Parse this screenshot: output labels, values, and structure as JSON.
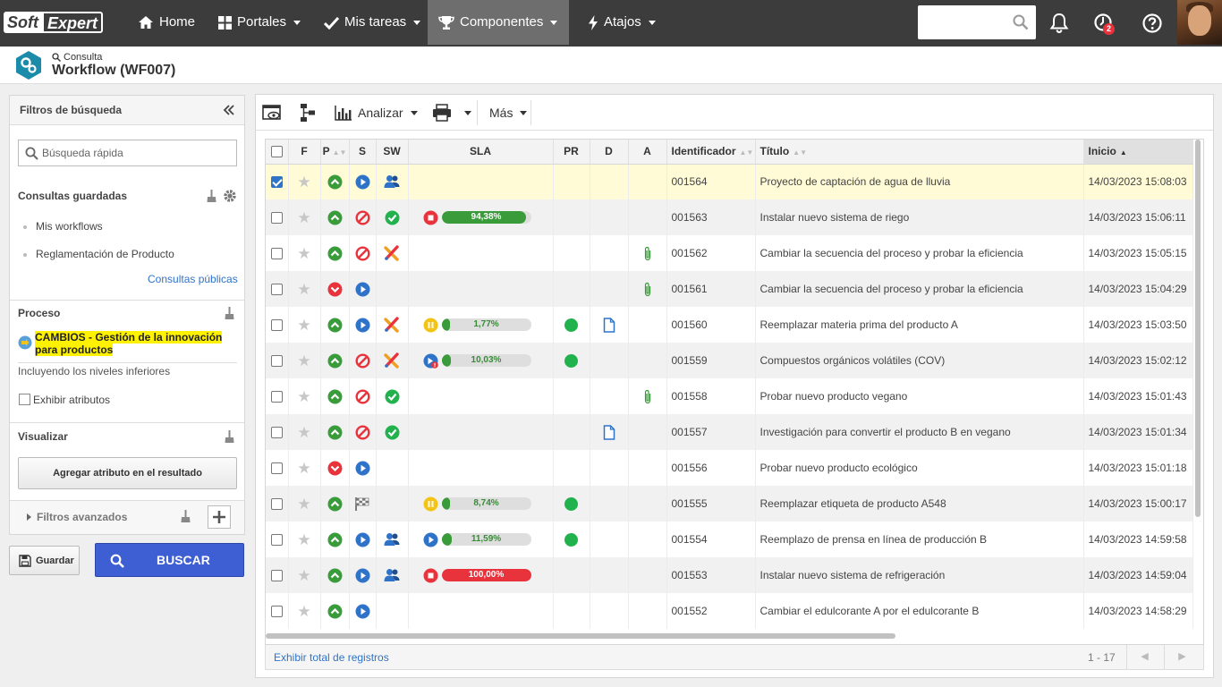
{
  "brand": {
    "part1": "Soft",
    "part2": "Expert"
  },
  "nav": [
    {
      "label": "Home",
      "icon": "home-icon"
    },
    {
      "label": "Portales",
      "icon": "grid-icon"
    },
    {
      "label": "Mis tareas",
      "icon": "check-icon"
    },
    {
      "label": "Componentes",
      "icon": "trophy-icon",
      "active": true
    },
    {
      "label": "Atajos",
      "icon": "bolt-icon"
    }
  ],
  "search": {
    "placeholder": ""
  },
  "notifications": {
    "badge": "2"
  },
  "header": {
    "small": "Consulta",
    "title": "Workflow (WF007)"
  },
  "filters": {
    "title": "Filtros de búsqueda",
    "quick_search_placeholder": "Búsqueda rápida",
    "saved_title": "Consultas guardadas",
    "saved_items": [
      "Mis workflows",
      "Reglamentación de Producto"
    ],
    "public_link": "Consultas públicas",
    "process_title": "Proceso",
    "process_value_line1": "CAMBIOS - Gestión de la innovación",
    "process_value_line2": "para productos",
    "include_levels": "Incluyendo los niveles inferiores",
    "show_attributes": "Exhibir atributos",
    "visualize_title": "Visualizar",
    "add_attribute_button": "Agregar atributo en el resultado",
    "advanced_filters": "Filtros avanzados",
    "save_button": "Guardar",
    "search_button": "BUSCAR"
  },
  "toolbar": {
    "analyze": "Analizar",
    "more": "Más"
  },
  "table": {
    "columns": {
      "f": "F",
      "p": "P",
      "s": "S",
      "sw": "SW",
      "sla": "SLA",
      "pr": "PR",
      "d": "D",
      "a": "A",
      "id": "Identificador",
      "title": "Título",
      "start": "Inicio"
    },
    "rows": [
      {
        "checked": true,
        "p": "up",
        "s": "play",
        "sw": "user",
        "sla": null,
        "pr": false,
        "d": false,
        "a": false,
        "id": "001564",
        "title": "Proyecto de captación de agua de lluvia",
        "start": "14/03/2023 15:08:03"
      },
      {
        "checked": false,
        "p": "up",
        "s": "stop",
        "sw": "check",
        "sla": {
          "icon": "stop",
          "label": "94,38%",
          "pct": 94.38,
          "color": "#3a9b3a"
        },
        "pr": false,
        "d": false,
        "a": false,
        "id": "001563",
        "title": "Instalar nuevo sistema de riego",
        "start": "14/03/2023 15:06:11"
      },
      {
        "checked": false,
        "p": "up",
        "s": "stop",
        "sw": "cross",
        "sla": null,
        "pr": false,
        "d": false,
        "a": true,
        "id": "001562",
        "title": "Cambiar la secuencia del proceso y probar la eficiencia",
        "start": "14/03/2023 15:05:15"
      },
      {
        "checked": false,
        "p": "down",
        "s": "play",
        "sw": null,
        "sla": null,
        "pr": false,
        "d": false,
        "a": true,
        "id": "001561",
        "title": "Cambiar la secuencia del proceso y probar la eficiencia",
        "start": "14/03/2023 15:04:29"
      },
      {
        "checked": false,
        "p": "up",
        "s": "play",
        "sw": "cross",
        "sla": {
          "icon": "pause",
          "label": "1,77%",
          "pct": 1.77,
          "color": "#3a9b3a"
        },
        "pr": true,
        "d": true,
        "a": false,
        "id": "001560",
        "title": "Reemplazar materia prima del producto A",
        "start": "14/03/2023 15:03:50"
      },
      {
        "checked": false,
        "p": "up",
        "s": "stop",
        "sw": "cross",
        "sla": {
          "icon": "play-alert",
          "label": "10,03%",
          "pct": 10.03,
          "color": "#3a9b3a"
        },
        "pr": true,
        "d": false,
        "a": false,
        "id": "001559",
        "title": "Compuestos orgánicos volátiles (COV)",
        "start": "14/03/2023 15:02:12"
      },
      {
        "checked": false,
        "p": "up",
        "s": "stop",
        "sw": "check",
        "sla": null,
        "pr": false,
        "d": false,
        "a": true,
        "id": "001558",
        "title": "Probar nuevo producto vegano",
        "start": "14/03/2023 15:01:43"
      },
      {
        "checked": false,
        "p": "up",
        "s": "stop",
        "sw": "check",
        "sla": null,
        "pr": false,
        "d": true,
        "a": false,
        "id": "001557",
        "title": "Investigación para convertir el producto B en vegano",
        "start": "14/03/2023 15:01:34"
      },
      {
        "checked": false,
        "p": "down",
        "s": "play",
        "sw": null,
        "sla": null,
        "pr": false,
        "d": false,
        "a": false,
        "id": "001556",
        "title": "Probar nuevo producto ecológico",
        "start": "14/03/2023 15:01:18"
      },
      {
        "checked": false,
        "p": "up",
        "s": "flag",
        "sw": null,
        "sla": {
          "icon": "pause",
          "label": "8,74%",
          "pct": 8.74,
          "color": "#3a9b3a"
        },
        "pr": true,
        "d": false,
        "a": false,
        "id": "001555",
        "title": "Reemplazar etiqueta de producto A548",
        "start": "14/03/2023 15:00:17"
      },
      {
        "checked": false,
        "p": "up",
        "s": "play",
        "sw": "user",
        "sla": {
          "icon": "play",
          "label": "11,59%",
          "pct": 11.59,
          "color": "#3a9b3a"
        },
        "pr": true,
        "d": false,
        "a": false,
        "id": "001554",
        "title": "Reemplazo de prensa en línea de producción B",
        "start": "14/03/2023 14:59:58"
      },
      {
        "checked": false,
        "p": "up",
        "s": "play",
        "sw": "user",
        "sla": {
          "icon": "stop",
          "label": "100,00%",
          "pct": 100,
          "color": "#e8323c"
        },
        "pr": false,
        "d": false,
        "a": false,
        "id": "001553",
        "title": "Instalar nuevo sistema de refrigeración",
        "start": "14/03/2023 14:59:04"
      },
      {
        "checked": false,
        "p": "up",
        "s": "play",
        "sw": null,
        "sla": null,
        "pr": false,
        "d": false,
        "a": false,
        "id": "001552",
        "title": "Cambiar el edulcorante A por el edulcorante B",
        "start": "14/03/2023 14:58:29"
      }
    ]
  },
  "footer": {
    "show_total": "Exhibir total de registros",
    "count": "1 - 17"
  },
  "colors": {
    "topbar": "#3c3c3c",
    "active_nav": "#6e6e6e",
    "primary": "#3d5fd3",
    "green": "#3a9b3a",
    "red": "#e8323c",
    "blue": "#2f73c9",
    "selected_row": "#fffbd6"
  }
}
